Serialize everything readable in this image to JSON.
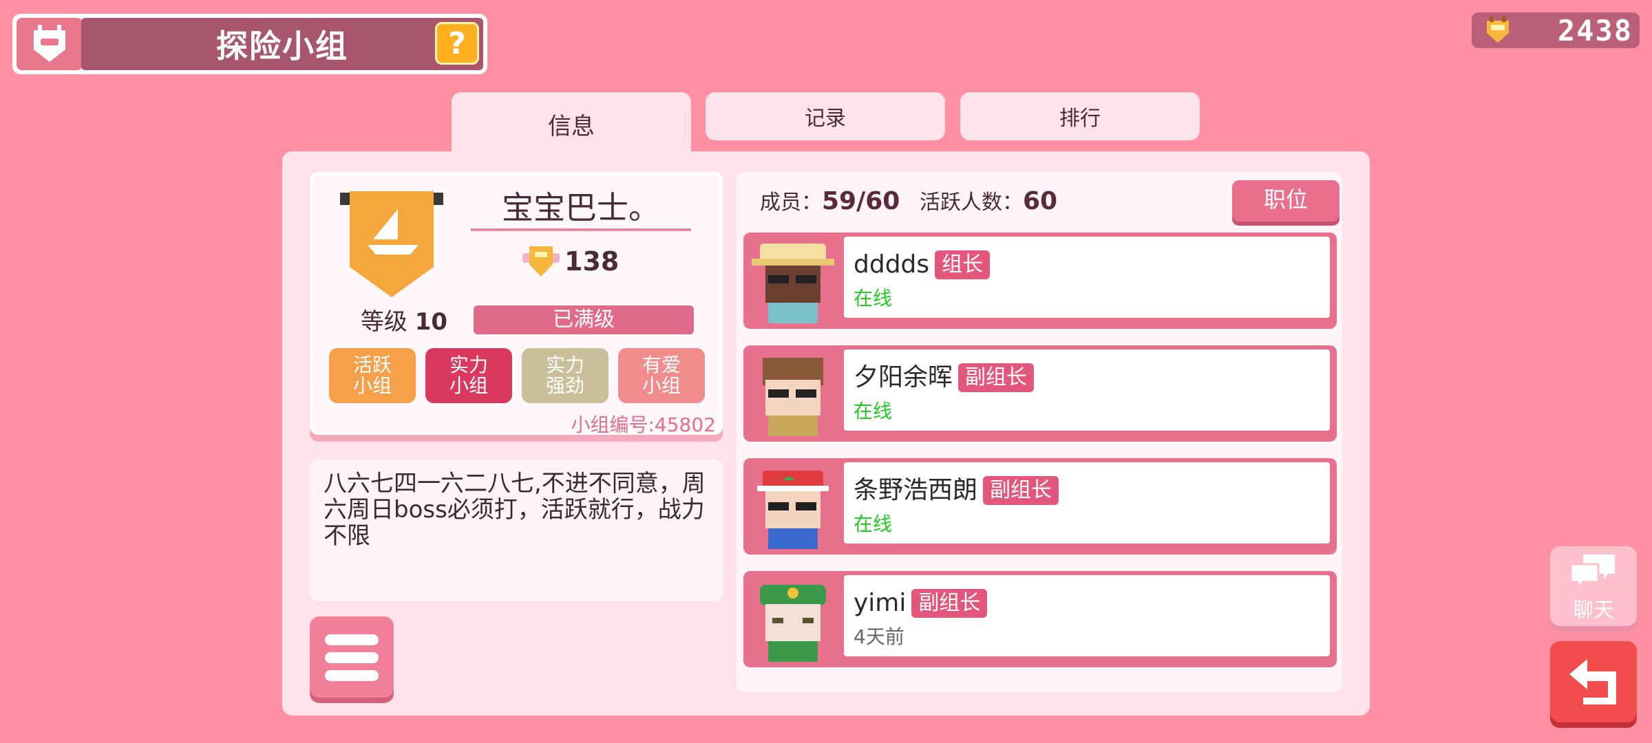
{
  "header": {
    "title": "探险小组",
    "help_label": "?"
  },
  "currency": {
    "value": "2438",
    "icon": "coin-icon"
  },
  "tabs": [
    {
      "label": "信息",
      "active": true
    },
    {
      "label": "记录",
      "active": false
    },
    {
      "label": "排行",
      "active": false
    }
  ],
  "group": {
    "name": "宝宝巴士。",
    "score": "138",
    "level_label": "等级",
    "level_value": "10",
    "max_label": "已满级",
    "tags": [
      "活跃\n小组",
      "实力\n小组",
      "实力\n强劲",
      "有爱\n小组"
    ],
    "id_label": "小组编号:",
    "id_value": "45802",
    "description": "八六七四一六二八七,不进不同意，周六周日boss必须打，活跃就行，战力不限"
  },
  "members": {
    "count_label": "成员：",
    "count_value": "59/60",
    "active_label": "活跃人数：",
    "active_value": "60",
    "role_button": "职位",
    "list": [
      {
        "name": "dddds",
        "role": "组长",
        "status": "在线",
        "online": true
      },
      {
        "name": "夕阳余晖",
        "role": "副组长",
        "status": "在线",
        "online": true
      },
      {
        "name": "条野浩西朗",
        "role": "副组长",
        "status": "在线",
        "online": true
      },
      {
        "name": "yimi",
        "role": "副组长",
        "status": "4天前",
        "online": false
      }
    ]
  },
  "side_buttons": {
    "chat_label": "聊天"
  },
  "colors": {
    "background": "#ff8fa3",
    "accent": "#e7718c",
    "online": "#22cc22"
  }
}
